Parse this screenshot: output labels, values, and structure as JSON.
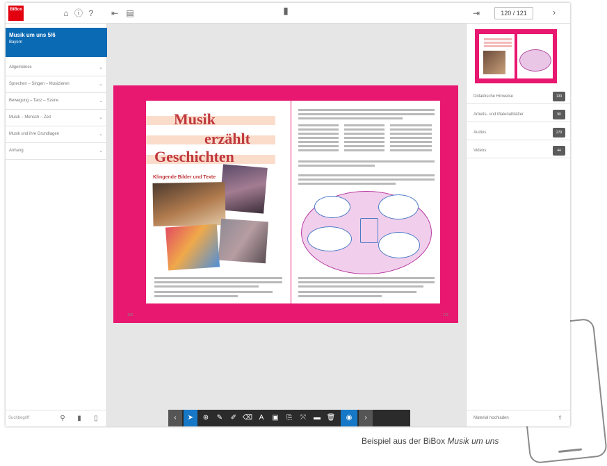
{
  "caption": {
    "prefix": "Beispiel aus der BiBox ",
    "title": "Musik um uns"
  },
  "header": {
    "logo": "BiBox",
    "page_indicator": "120 / 121"
  },
  "sidebar": {
    "book_title": "Musik um uns 5/6",
    "book_subtitle": "Bayern",
    "items": [
      {
        "label": "Allgemeines"
      },
      {
        "label": "Sprechen – Singen – Musizieren"
      },
      {
        "label": "Bewegung – Tanz – Szene"
      },
      {
        "label": "Musik – Mensch – Zeit"
      },
      {
        "label": "Musik und ihre Grundlagen"
      },
      {
        "label": "Anhang"
      }
    ],
    "search_placeholder": "Suchbegriff"
  },
  "materials": {
    "items": [
      {
        "label": "Didaktische Hinweise",
        "count": "133"
      },
      {
        "label": "Arbeits- und Materialblätter",
        "count": "90"
      },
      {
        "label": "Audios",
        "count": "279"
      },
      {
        "label": "Videos",
        "count": "44"
      }
    ],
    "upload_label": "Material hochladen"
  },
  "spread": {
    "title_line1": "Musik",
    "title_line2": "erzählt",
    "title_line3": "Geschichten",
    "subtitle": "Klingende Bilder und Texte",
    "left_page_number": "120",
    "right_page_number": "121"
  },
  "colors": {
    "brand_red": "#e3000f",
    "header_blue": "#0a6ab4",
    "spread_pink": "#e8176f",
    "title_red": "#c0393d",
    "toolbar_blue": "#1678c6"
  }
}
